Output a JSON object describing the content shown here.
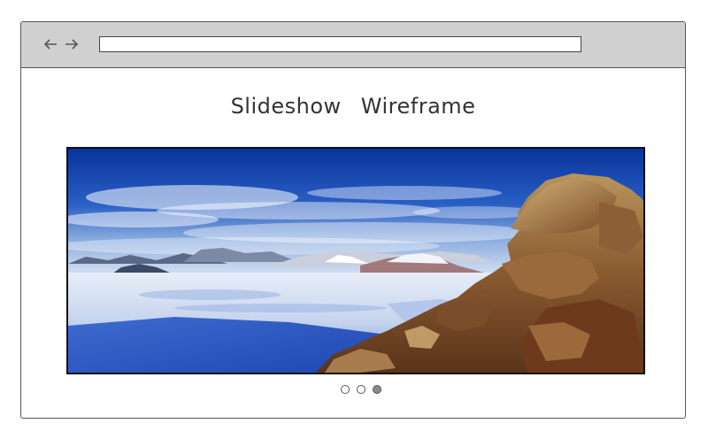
{
  "browser": {
    "nav_icons": [
      "back-arrow-icon",
      "forward-arrow-icon"
    ],
    "address_value": ""
  },
  "page": {
    "title": "Slideshow Wireframe"
  },
  "slideshow": {
    "slide_count": 3,
    "active_index": 2,
    "current_slide": "antarctic-landscape-image"
  },
  "colors": {
    "toolbar_bg": "#d0d0d0",
    "frame_border": "#111111",
    "dot_active": "#8a8a8a"
  }
}
